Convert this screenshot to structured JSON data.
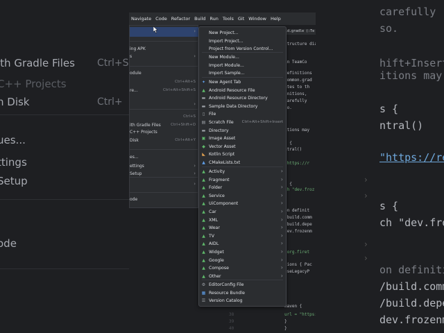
{
  "menubar": [
    "Navigate",
    "Code",
    "Refactor",
    "Build",
    "Run",
    "Tools",
    "Git",
    "Window",
    "Help"
  ],
  "background_left": {
    "items": [
      {
        "text": "ith Gradle Files",
        "shortcut": "Ctrl+Sh",
        "dim": false
      },
      {
        "text": "C++ Projects",
        "shortcut": "",
        "dim": true
      },
      {
        "text": "n Disk",
        "shortcut": "Ctrl+",
        "dim": false
      },
      {
        "text": "ues...",
        "shortcut": "",
        "dim": false
      },
      {
        "text": "ttings",
        "shortcut": "",
        "dim": false
      },
      {
        "text": "Setup",
        "shortcut": "",
        "dim": false
      },
      {
        "text": "ode",
        "shortcut": "",
        "dim": false
      }
    ]
  },
  "background_right": {
    "lines": [
      {
        "text": "carefully",
        "cls": "gray"
      },
      {
        "text": "so.",
        "cls": "gray"
      },
      {
        "text": "hift+Insert",
        "cls": "gray"
      },
      {
        "text": "itions may",
        "cls": "gray"
      },
      {
        "text": "s {",
        "cls": ""
      },
      {
        "text": "ntral()",
        "cls": ""
      },
      {
        "text": "\"https://re",
        "cls": "link"
      },
      {
        "text": "s {",
        "cls": ""
      },
      {
        "text": "ch \"dev.froz",
        "cls": ""
      },
      {
        "text": "on definiti",
        "cls": "gray"
      },
      {
        "text": "/build.comm",
        "cls": ""
      },
      {
        "text": "/build.depe",
        "cls": ""
      },
      {
        "text": "dev.frozenm",
        "cls": ""
      }
    ]
  },
  "file_menu": {
    "rows": [
      {
        "label": "",
        "shortcut": "",
        "arrow": true
      },
      {
        "label": "ing APK",
        "shortcut": "",
        "arrow": false
      },
      {
        "label": "s",
        "shortcut": "",
        "arrow": true
      },
      {
        "label": "odule",
        "shortcut": "",
        "arrow": false
      },
      {
        "label": "",
        "shortcut": "Ctrl+Alt+S",
        "arrow": false
      },
      {
        "label": "re...",
        "shortcut": "Ctrl+Alt+Shift+S",
        "arrow": false
      },
      {
        "label": "",
        "shortcut": "",
        "arrow": true
      },
      {
        "label": "",
        "shortcut": "Ctrl+S",
        "arrow": false
      },
      {
        "label": "ith Gradle Files",
        "shortcut": "Ctrl+Shift+O",
        "arrow": false
      },
      {
        "label": "C++ Projects",
        "shortcut": "",
        "arrow": false
      },
      {
        "label": "Disk",
        "shortcut": "Ctrl+Alt+Y",
        "arrow": false
      },
      {
        "label": "es...",
        "shortcut": "",
        "arrow": false
      },
      {
        "label": "ettings",
        "shortcut": "",
        "arrow": true
      },
      {
        "label": "Setup",
        "shortcut": "",
        "arrow": true
      },
      {
        "label": "",
        "shortcut": "",
        "arrow": true
      },
      {
        "label": "ode",
        "shortcut": "",
        "arrow": false
      }
    ]
  },
  "new_menu": {
    "items": [
      {
        "label": "New Project...",
        "icon": "none",
        "shortcut": "",
        "arrow": false
      },
      {
        "label": "Import Project...",
        "icon": "none",
        "shortcut": "",
        "arrow": false
      },
      {
        "label": "Project from Version Control...",
        "icon": "none",
        "shortcut": "",
        "arrow": false
      },
      {
        "label": "New Module...",
        "icon": "none",
        "shortcut": "",
        "arrow": false
      },
      {
        "label": "Import Module...",
        "icon": "none",
        "shortcut": "",
        "arrow": false
      },
      {
        "label": "Import Sample...",
        "icon": "none",
        "shortcut": "",
        "arrow": false
      },
      {
        "label": "New Agent Tab",
        "icon": "sparkle",
        "shortcut": "",
        "arrow": false
      },
      {
        "label": "Android Resource File",
        "icon": "android",
        "shortcut": "",
        "arrow": false
      },
      {
        "label": "Android Resource Directory",
        "icon": "folder",
        "shortcut": "",
        "arrow": false
      },
      {
        "label": "Sample Data Directory",
        "icon": "folder",
        "shortcut": "",
        "arrow": false
      },
      {
        "label": "File",
        "icon": "file",
        "shortcut": "",
        "arrow": false
      },
      {
        "label": "Scratch File",
        "icon": "scratch",
        "shortcut": "Ctrl+Alt+Shift+Insert",
        "arrow": false
      },
      {
        "label": "Directory",
        "icon": "folder",
        "shortcut": "",
        "arrow": false
      },
      {
        "label": "Image Asset",
        "icon": "image",
        "shortcut": "",
        "arrow": false
      },
      {
        "label": "Vector Asset",
        "icon": "vector",
        "shortcut": "",
        "arrow": false
      },
      {
        "label": "Kotlin Script",
        "icon": "kotlin",
        "shortcut": "",
        "arrow": false
      },
      {
        "label": "CMakeLists.txt",
        "icon": "cmake",
        "shortcut": "",
        "arrow": false
      },
      {
        "label": "Activity",
        "icon": "android",
        "shortcut": "",
        "arrow": true
      },
      {
        "label": "Fragment",
        "icon": "android",
        "shortcut": "",
        "arrow": true
      },
      {
        "label": "Folder",
        "icon": "android",
        "shortcut": "",
        "arrow": true
      },
      {
        "label": "Service",
        "icon": "android",
        "shortcut": "",
        "arrow": true
      },
      {
        "label": "UiComponent",
        "icon": "android",
        "shortcut": "",
        "arrow": true
      },
      {
        "label": "Car",
        "icon": "android",
        "shortcut": "",
        "arrow": true
      },
      {
        "label": "XML",
        "icon": "android",
        "shortcut": "",
        "arrow": true
      },
      {
        "label": "Wear",
        "icon": "android",
        "shortcut": "",
        "arrow": true
      },
      {
        "label": "TV",
        "icon": "android",
        "shortcut": "",
        "arrow": true
      },
      {
        "label": "AIDL",
        "icon": "android",
        "shortcut": "",
        "arrow": true
      },
      {
        "label": "Widget",
        "icon": "android",
        "shortcut": "",
        "arrow": true
      },
      {
        "label": "Google",
        "icon": "android",
        "shortcut": "",
        "arrow": true
      },
      {
        "label": "Compose",
        "icon": "android",
        "shortcut": "",
        "arrow": true
      },
      {
        "label": "Other",
        "icon": "android",
        "shortcut": "",
        "arrow": true
      },
      {
        "label": "EditorConfig File",
        "icon": "gear",
        "shortcut": "",
        "arrow": false
      },
      {
        "label": "Resource Bundle",
        "icon": "bundle",
        "shortcut": "",
        "arrow": false
      },
      {
        "label": "Version Catalog",
        "icon": "catalog",
        "shortcut": "",
        "arrow": false
      }
    ]
  },
  "editor": {
    "tab": "ild.gradle (:Te",
    "lines": [
      {
        "n": "",
        "t": "structure dialo",
        "c": ""
      },
      {
        "n": "",
        "t": "in TeamCo",
        "c": ""
      },
      {
        "n": "",
        "t": "definitions",
        "c": ""
      },
      {
        "n": "",
        "t": "common.grad",
        "c": ""
      },
      {
        "n": "",
        "t": "ates to th",
        "c": ""
      },
      {
        "n": "",
        "t": "initions,",
        "c": ""
      },
      {
        "n": "",
        "t": "carefully",
        "c": ""
      },
      {
        "n": "",
        "t": "so.",
        "c": ""
      },
      {
        "n": "",
        "t": "itions may",
        "c": ""
      },
      {
        "n": "",
        "t": "s {",
        "c": ""
      },
      {
        "n": "",
        "t": "ntral()",
        "c": ""
      },
      {
        "n": "",
        "t": "\"https://r",
        "c": "str"
      },
      {
        "n": "",
        "t": "s {",
        "c": ""
      },
      {
        "n": "",
        "t": "ch \"dev.froz",
        "c": "str"
      },
      {
        "n": "",
        "t": "on definit",
        "c": ""
      },
      {
        "n": "",
        "t": "/build.comm",
        "c": ""
      },
      {
        "n": "",
        "t": "/build.depe",
        "c": ""
      },
      {
        "n": "",
        "t": "dev.frozenm",
        "c": ""
      },
      {
        "n": "",
        "t": "\"org.firet",
        "c": "str"
      },
      {
        "n": "",
        "t": "tions { Pac",
        "c": ""
      },
      {
        "n": "",
        "t": "useLegacyP",
        "c": ""
      },
      {
        "n": "",
        "t": "maven {",
        "c": ""
      },
      {
        "n": "38",
        "t": "url = \"https://rep",
        "c": "str"
      },
      {
        "n": "39",
        "t": "}",
        "c": ""
      },
      {
        "n": "40",
        "t": "}",
        "c": ""
      }
    ]
  }
}
